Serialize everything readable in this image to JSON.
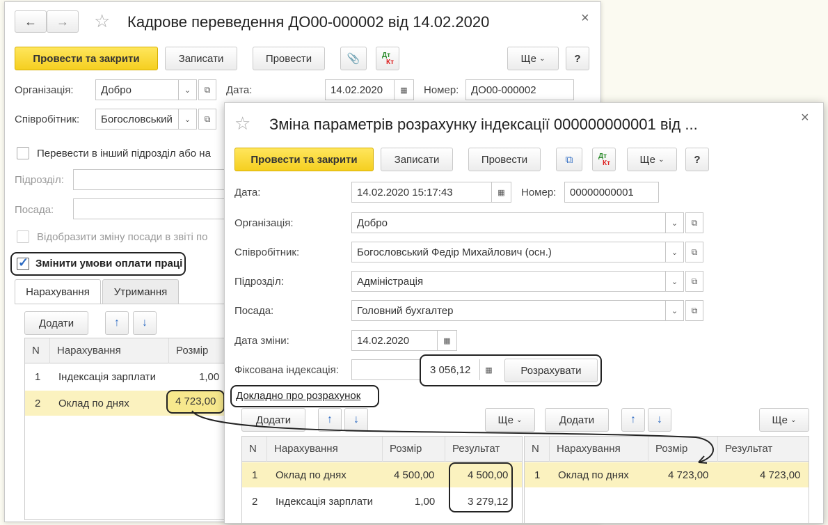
{
  "win1": {
    "title": "Кадрове переведення ДО00-000002 від 14.02.2020",
    "toolbar": {
      "post_close": "Провести та закрити",
      "save": "Записати",
      "post": "Провести",
      "more": "Ще",
      "help": "?"
    },
    "org_label": "Організація:",
    "org_value": "Добро",
    "date_label": "Дата:",
    "date_value": "14.02.2020",
    "number_label": "Номер:",
    "number_value": "ДО00-000002",
    "employee_label": "Співробітник:",
    "employee_value": "Богословський",
    "transfer_checkbox": "Перевести в інший підрозділ або на",
    "dept_label": "Підрозділ:",
    "position_label": "Посада:",
    "show_change_checkbox": "Відобразити зміну посади в звіті по",
    "change_pay_checkbox": "Змінити умови оплати праці",
    "tabs": [
      "Нарахування",
      "Утримання"
    ],
    "add_button": "Додати",
    "table": {
      "headers": [
        "N",
        "Нарахування",
        "Розмір"
      ],
      "rows": [
        {
          "n": "1",
          "name": "Індексація зарплати",
          "size": "1,00"
        },
        {
          "n": "2",
          "name": "Оклад по днях",
          "size": "4 723,00"
        }
      ]
    }
  },
  "win2": {
    "title": "Зміна параметрів розрахунку індексації 000000000001 від ...",
    "toolbar": {
      "post_close": "Провести та закрити",
      "save": "Записати",
      "post": "Провести",
      "more": "Ще",
      "help": "?"
    },
    "date_label": "Дата:",
    "date_value": "14.02.2020 15:17:43",
    "number_label": "Номер:",
    "number_value": "00000000001",
    "org_label": "Організація:",
    "org_value": "Добро",
    "employee_label": "Співробітник:",
    "employee_value": "Богословський Федір Михайлович (осн.)",
    "dept_label": "Підрозділ:",
    "dept_value": "Адміністрація",
    "position_label": "Посада:",
    "position_value": "Головний бухгалтер",
    "change_date_label": "Дата зміни:",
    "change_date_value": "14.02.2020",
    "fixed_index_label": "Фіксована індексація:",
    "fixed_index_value": "3 056,12",
    "calculate_button": "Розрахувати",
    "details_link": "Докладно про розрахунок",
    "left": {
      "add_button": "Додати",
      "more": "Ще",
      "headers": [
        "N",
        "Нарахування",
        "Розмір",
        "Результат"
      ],
      "rows": [
        {
          "n": "1",
          "name": "Оклад по днях",
          "size": "4 500,00",
          "result": "4 500,00"
        },
        {
          "n": "2",
          "name": "Індексація зарплати",
          "size": "1,00",
          "result": "3 279,12"
        }
      ]
    },
    "right": {
      "add_button": "Додати",
      "more": "Ще",
      "headers": [
        "N",
        "Нарахування",
        "Розмір",
        "Результат"
      ],
      "rows": [
        {
          "n": "1",
          "name": "Оклад по днях",
          "size": "4 723,00",
          "result": "4 723,00"
        }
      ]
    }
  },
  "icons": {
    "back": "arrow-left-icon",
    "forward": "arrow-right-icon",
    "star": "star-icon",
    "clip": "paperclip-icon",
    "calendar": "calendar-icon",
    "copy": "copy-icon"
  },
  "colors": {
    "accent_yellow": "#f5cf20",
    "selected_row": "#fbf2bf",
    "arrow_blue": "#2d6bc2"
  }
}
